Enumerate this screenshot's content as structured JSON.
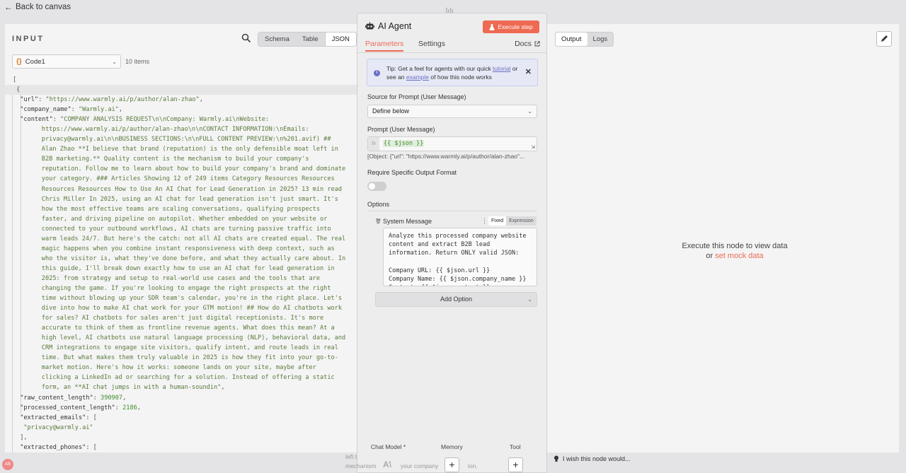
{
  "nav": {
    "back_label": "Back to canvas"
  },
  "input_panel": {
    "title": "INPUT",
    "view_modes": [
      "Schema",
      "Table",
      "JSON"
    ],
    "active_view": "JSON",
    "node_select": "Code1",
    "items_count": "10 items",
    "json_lines": [
      {
        "i": 0,
        "parts": [
          [
            "p",
            "["
          ]
        ]
      },
      {
        "i": 1,
        "hl": true,
        "parts": [
          [
            "p",
            "{"
          ]
        ]
      },
      {
        "i": 2,
        "parts": [
          [
            "k",
            "\"url\""
          ],
          [
            "p",
            ": "
          ],
          [
            "s",
            "\"https://www.warmly.ai/p/author/alan-zhao\""
          ],
          [
            "p",
            ","
          ]
        ]
      },
      {
        "i": 2,
        "parts": [
          [
            "k",
            "\"company_name\""
          ],
          [
            "p",
            ": "
          ],
          [
            "s",
            "\"Warmly.ai\""
          ],
          [
            "p",
            ","
          ]
        ]
      },
      {
        "i": 2,
        "parts": [
          [
            "k",
            "\"content\""
          ],
          [
            "p",
            ": "
          ],
          [
            "s",
            "\"COMPANY ANALYSIS REQUEST\\n\\nCompany: Warmly.ai\\nWebsite:"
          ]
        ]
      },
      {
        "i": 8,
        "parts": [
          [
            "s",
            "https://www.warmly.ai/p/author/alan-zhao\\n\\nCONTACT INFORMATION:\\nEmails:"
          ]
        ]
      },
      {
        "i": 8,
        "parts": [
          [
            "s",
            "privacy@warmly.ai\\n\\nBUSINESS SECTIONS:\\n\\nFULL CONTENT PREVIEW:\\n%201.avif) ##"
          ]
        ]
      },
      {
        "i": 8,
        "parts": [
          [
            "s",
            "Alan Zhao **I believe that brand (reputation) is the only defensible moat left in"
          ]
        ]
      },
      {
        "i": 8,
        "parts": [
          [
            "s",
            "B2B marketing.** Quality content is the mechanism to build your company's"
          ]
        ]
      },
      {
        "i": 8,
        "parts": [
          [
            "s",
            "reputation. Follow me to learn about how to build your company's brand and dominate"
          ]
        ]
      },
      {
        "i": 8,
        "parts": [
          [
            "s",
            "your category. ### Articles Showing 12 of 249 items Category Resources Resources"
          ]
        ]
      },
      {
        "i": 8,
        "parts": [
          [
            "s",
            "Resources Resources How to Use An AI Chat for Lead Generation in 2025? 13 min read"
          ]
        ]
      },
      {
        "i": 8,
        "parts": [
          [
            "s",
            "Chris Miller In 2025, using an AI chat for lead generation isn't just smart. It's"
          ]
        ]
      },
      {
        "i": 8,
        "parts": [
          [
            "s",
            "how the most effective teams are scaling conversations, qualifying prospects"
          ]
        ]
      },
      {
        "i": 8,
        "parts": [
          [
            "s",
            "faster, and driving pipeline on autopilot. Whether embedded on your website or"
          ]
        ]
      },
      {
        "i": 8,
        "parts": [
          [
            "s",
            "connected to your outbound workflows, AI chats are turning passive traffic into"
          ]
        ]
      },
      {
        "i": 8,
        "parts": [
          [
            "s",
            "warm leads 24/7. But here's the catch: not all AI chats are created equal. The real"
          ]
        ]
      },
      {
        "i": 8,
        "parts": [
          [
            "s",
            "magic happens when you combine instant responsiveness with deep context, such as"
          ]
        ]
      },
      {
        "i": 8,
        "parts": [
          [
            "s",
            "who the visitor is, what they've done before, and what they actually care about. In"
          ]
        ]
      },
      {
        "i": 8,
        "parts": [
          [
            "s",
            "this guide, I'll break down exactly how to use an AI chat for lead generation in"
          ]
        ]
      },
      {
        "i": 8,
        "parts": [
          [
            "s",
            "2025: from strategy and setup to real-world use cases and the tools that are"
          ]
        ]
      },
      {
        "i": 8,
        "parts": [
          [
            "s",
            "changing the game. If you're looking to engage the right prospects at the right"
          ]
        ]
      },
      {
        "i": 8,
        "parts": [
          [
            "s",
            "time without blowing up your SDR team's calendar, you're in the right place. Let's"
          ]
        ]
      },
      {
        "i": 8,
        "parts": [
          [
            "s",
            "dive into how to make AI chat work for your GTM motion! ## How do AI chatbots work"
          ]
        ]
      },
      {
        "i": 8,
        "parts": [
          [
            "s",
            "for sales? AI chatbots for sales aren't just digital receptionists. It's more"
          ]
        ]
      },
      {
        "i": 8,
        "parts": [
          [
            "s",
            "accurate to think of them as frontline revenue agents. What does this mean? At a"
          ]
        ]
      },
      {
        "i": 8,
        "parts": [
          [
            "s",
            "high level, AI chatbots use natural language processing (NLP), behavioral data, and"
          ]
        ]
      },
      {
        "i": 8,
        "parts": [
          [
            "s",
            "CRM integrations to engage site visitors, qualify intent, and route leads in real"
          ]
        ]
      },
      {
        "i": 8,
        "parts": [
          [
            "s",
            "time. But what makes them truly valuable in 2025 is how they fit into your go-to-"
          ]
        ]
      },
      {
        "i": 8,
        "parts": [
          [
            "s",
            "market motion. Here's how it works: someone lands on your site, maybe after"
          ]
        ]
      },
      {
        "i": 8,
        "parts": [
          [
            "s",
            "clicking a LinkedIn ad or searching for a solution. Instead of offering a static"
          ]
        ]
      },
      {
        "i": 8,
        "parts": [
          [
            "s",
            "form, an **AI chat jumps in with a human-soundin\""
          ],
          [
            "p",
            ","
          ]
        ]
      },
      {
        "i": 2,
        "parts": [
          [
            "k",
            "\"raw_content_length\""
          ],
          [
            "p",
            ": "
          ],
          [
            "n",
            "390907"
          ],
          [
            "p",
            ","
          ]
        ]
      },
      {
        "i": 2,
        "parts": [
          [
            "k",
            "\"processed_content_length\""
          ],
          [
            "p",
            ": "
          ],
          [
            "n",
            "2186"
          ],
          [
            "p",
            ","
          ]
        ]
      },
      {
        "i": 2,
        "parts": [
          [
            "k",
            "\"extracted_emails\""
          ],
          [
            "p",
            ": ["
          ]
        ]
      },
      {
        "i": 3,
        "parts": [
          [
            "s",
            "\"privacy@warmly.ai\""
          ]
        ]
      },
      {
        "i": 2,
        "parts": [
          [
            "p",
            "],"
          ]
        ]
      },
      {
        "i": 2,
        "parts": [
          [
            "k",
            "\"extracted_phones\""
          ],
          [
            "p",
            ": ["
          ]
        ]
      }
    ]
  },
  "ai_agent": {
    "title": "AI Agent",
    "execute_label": "Execute step",
    "tabs": [
      "Parameters",
      "Settings"
    ],
    "active_tab": "Parameters",
    "docs_label": "Docs",
    "tip": {
      "part1": "Tip: Get a feel for agents with our quick ",
      "link1": "tutorial",
      "part2": " or see an ",
      "link2": "example",
      "part3": " of how this node works"
    },
    "source_label": "Source for Prompt (User Message)",
    "source_value": "Define below",
    "prompt_label": "Prompt (User Message)",
    "prompt_fx": "fx",
    "prompt_value": "{{ $json }}",
    "prompt_preview": "[Object: {\"url\": \"https://www.warmly.ai/p/author/alan-zhao\"...",
    "output_format_label": "Require Specific Output Format",
    "output_format_enabled": false,
    "options_label": "Options",
    "system_message": {
      "label": "System Message",
      "modes": [
        "Fixed",
        "Expression"
      ],
      "active_mode": "Fixed",
      "text": "Analyze this processed company website\ncontent and extract B2B lead\ninformation. Return ONLY valid JSON:\n\nCompany URL: {{ $json.url }}\nCompany Name: {{ $json.company_name }}\nContent: {{ $json.content }}"
    },
    "add_option_label": "Add Option",
    "connectors": [
      {
        "label": "Chat Model *"
      },
      {
        "label": "Memory",
        "plus": "+"
      },
      {
        "label": "Tool",
        "plus": "+"
      }
    ]
  },
  "output_panel": {
    "modes": [
      "Output",
      "Logs"
    ],
    "active_mode": "Output",
    "msg_line1": "Execute this node to view data",
    "msg_or": "or ",
    "msg_link": "set mock data"
  },
  "footer": {
    "wish_label": "I wish this node would...",
    "bg_text_1": "left t",
    "bg_text_2": "mechanism",
    "bg_text_3": "your company",
    "bg_text_4": "ion.",
    "avatar_initials": "AB",
    "bg_logo": "A\\"
  },
  "colors": {
    "accent": "#ee6a52",
    "link_purple": "#6d6fc8",
    "json_string": "#5a7a3a",
    "json_number": "#3f8c2a"
  },
  "icons": {
    "back": "arrow-left-icon",
    "search": "search-icon",
    "robot": "robot-icon",
    "flask": "flask-icon",
    "external": "external-link-icon",
    "info": "info-icon",
    "close": "close-icon",
    "trash": "trash-icon",
    "menu": "dots-vertical-icon",
    "pencil": "pencil-icon",
    "bulb": "lightbulb-icon"
  }
}
